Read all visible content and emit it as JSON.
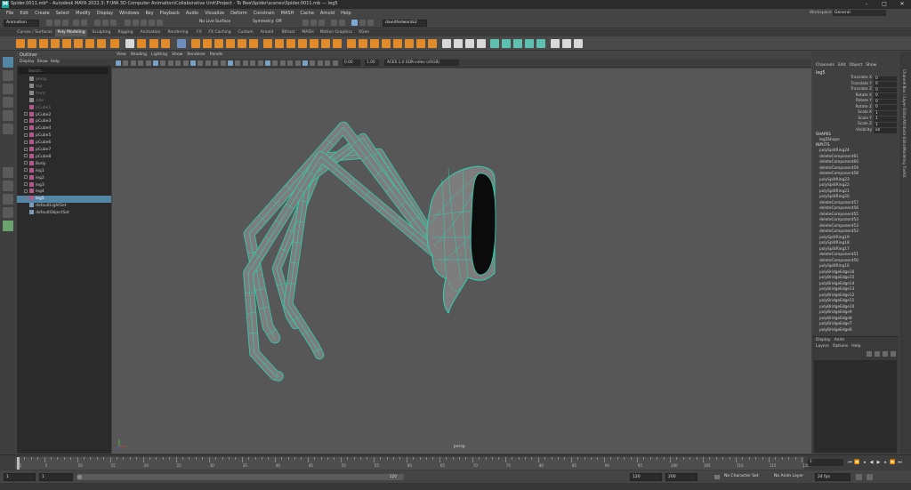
{
  "window": {
    "title": "Spider.0011.mb* - Autodesk MAYA 2022.3: F:\\MA 3D Computer Animation\\Collaborative Unit\\Project - To Bee\\Spider\\scenes\\Spider.0011.mb  ---  leg5",
    "workspace_label": "Workspace :",
    "workspace_value": "General"
  },
  "menubar": [
    "File",
    "Edit",
    "Create",
    "Select",
    "Modify",
    "Display",
    "Windows",
    "Key",
    "Playback",
    "Audio",
    "Visualize",
    "Deform",
    "Constrain",
    "MASH",
    "Cache",
    "Arnold",
    "Help"
  ],
  "statusline": {
    "mode": "Animation",
    "live_surface": "No Live Surface",
    "symmetry": "Symmetry: Off",
    "user": "davidfedwards2"
  },
  "shelf_tabs": [
    "Curves / Surfaces",
    "Poly Modeling",
    "Sculpting",
    "Rigging",
    "Animation",
    "Rendering",
    "FX",
    "FX Caching",
    "Custom",
    "Arnold",
    "Bifrost",
    "MASH",
    "Motion Graphics",
    "XGen"
  ],
  "shelf_active": "Poly Modeling",
  "outliner": {
    "title": "Outliner",
    "menu": [
      "Display",
      "Show",
      "Help"
    ],
    "search_placeholder": "Search...",
    "items": [
      {
        "label": "persp",
        "dim": true,
        "type": "cam"
      },
      {
        "label": "top",
        "dim": true,
        "type": "cam"
      },
      {
        "label": "front",
        "dim": true,
        "type": "cam"
      },
      {
        "label": "side",
        "dim": true,
        "type": "cam"
      },
      {
        "label": "pCube1",
        "dim": true,
        "type": "mesh"
      },
      {
        "label": "pCube2",
        "dim": false,
        "type": "mesh"
      },
      {
        "label": "pCube3",
        "dim": false,
        "type": "mesh"
      },
      {
        "label": "pCube4",
        "dim": false,
        "type": "mesh"
      },
      {
        "label": "pCube5",
        "dim": false,
        "type": "mesh"
      },
      {
        "label": "pCube6",
        "dim": false,
        "type": "mesh"
      },
      {
        "label": "pCube7",
        "dim": false,
        "type": "mesh"
      },
      {
        "label": "pCube8",
        "dim": false,
        "type": "mesh"
      },
      {
        "label": "Body",
        "dim": false,
        "type": "mesh"
      },
      {
        "label": "leg1",
        "dim": false,
        "type": "mesh"
      },
      {
        "label": "leg2",
        "dim": false,
        "type": "mesh"
      },
      {
        "label": "leg3",
        "dim": false,
        "type": "mesh"
      },
      {
        "label": "leg4",
        "dim": false,
        "type": "mesh"
      },
      {
        "label": "leg5",
        "dim": false,
        "type": "mesh",
        "selected": true
      },
      {
        "label": "defaultLightSet",
        "dim": false,
        "type": "set"
      },
      {
        "label": "defaultObjectSet",
        "dim": false,
        "type": "set"
      }
    ]
  },
  "viewport": {
    "menu": [
      "View",
      "Shading",
      "Lighting",
      "Show",
      "Renderer",
      "Panels"
    ],
    "exposure": "0.00",
    "gamma": "1.00",
    "colorspace": "ACES 1.0 SDR-video (sRGB)",
    "camera": "persp"
  },
  "channelbox": {
    "menu": [
      "Channels",
      "Edit",
      "Object",
      "Show"
    ],
    "object": "leg5",
    "attributes": [
      {
        "label": "Translate X",
        "value": "0"
      },
      {
        "label": "Translate Y",
        "value": "0"
      },
      {
        "label": "Translate Z",
        "value": "0"
      },
      {
        "label": "Rotate X",
        "value": "0"
      },
      {
        "label": "Rotate Y",
        "value": "0"
      },
      {
        "label": "Rotate Z",
        "value": "0"
      },
      {
        "label": "Scale X",
        "value": "1"
      },
      {
        "label": "Scale Y",
        "value": "1"
      },
      {
        "label": "Scale Z",
        "value": "1"
      },
      {
        "label": "Visibility",
        "value": "on"
      }
    ],
    "shapes_header": "SHAPES",
    "shape": "leg5Shape",
    "inputs_header": "INPUTS",
    "inputs": [
      "polySplitRing24",
      "deleteComponent61",
      "deleteComponent60",
      "deleteComponent59",
      "deleteComponent58",
      "polySplitRing23",
      "polySplitRing22",
      "polySplitRing21",
      "polySplitRing20",
      "deleteComponent57",
      "deleteComponent56",
      "deleteComponent55",
      "deleteComponent54",
      "deleteComponent53",
      "deleteComponent52",
      "polySplitRing19",
      "polySplitRing18",
      "polySplitRing17",
      "deleteComponent51",
      "deleteComponent50",
      "polySplitRing16",
      "polyBridgeEdge16",
      "polyBridgeEdge15",
      "polyBridgeEdge14",
      "polyBridgeEdge13",
      "polyBridgeEdge12",
      "polyBridgeEdge11",
      "polyBridgeEdge10",
      "polyBridgeEdge9",
      "polyBridgeEdge8",
      "polyBridgeEdge7",
      "polyBridgeEdge6"
    ]
  },
  "layers": {
    "tabs": [
      "Display",
      "Anim"
    ],
    "menu": [
      "Layers",
      "Options",
      "Help"
    ]
  },
  "side_strip": [
    "Channel Box / Layer Editor",
    "Attribute Editor",
    "Modeling Toolkit"
  ],
  "timeslider": {
    "ticks": [
      "5",
      "10",
      "15",
      "20",
      "25",
      "30",
      "35",
      "40",
      "45",
      "50",
      "55",
      "60",
      "65",
      "70",
      "75",
      "80",
      "85",
      "90",
      "95",
      "100",
      "105",
      "110",
      "115",
      "120"
    ],
    "start_tick": "1",
    "current_frame": "1"
  },
  "rangeslider": {
    "start": "1",
    "range_start": "1",
    "range_end_label": "120",
    "end": "120",
    "anim_end": "200",
    "character_set": "No Character Set",
    "anim_layer": "No Anim Layer",
    "fps": "24 fps"
  },
  "colors": {
    "accent": "#5285a6",
    "wire": "#2ad4b0",
    "mesh": "#7d7d7d",
    "viewport_bg": "#575757"
  }
}
